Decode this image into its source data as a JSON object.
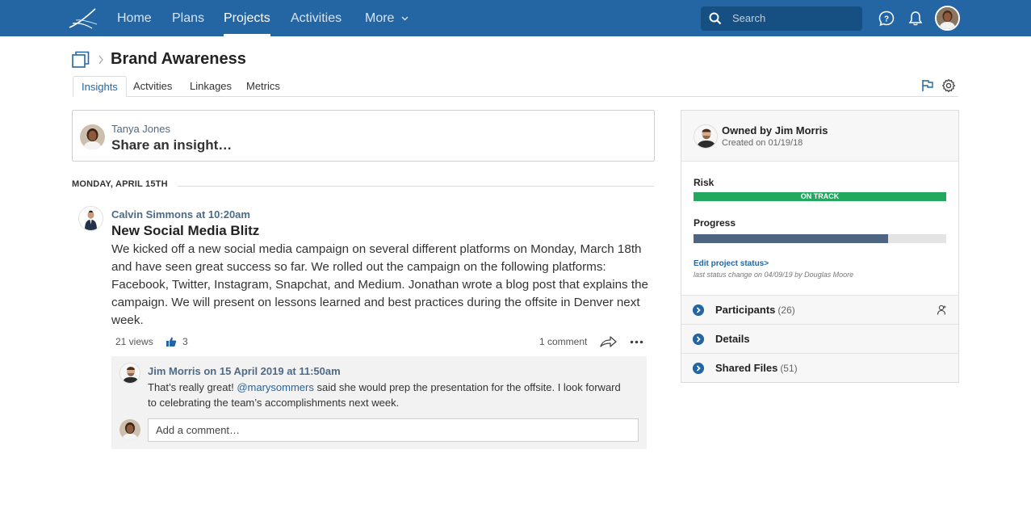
{
  "nav": {
    "items": [
      "Home",
      "Plans",
      "Projects",
      "Activities",
      "More"
    ],
    "active": "Projects",
    "search_placeholder": "Search",
    "brand_color": "#2366a3"
  },
  "page": {
    "title": "Brand Awareness",
    "tabs": [
      "Insights",
      "Actvities",
      "Linkages",
      "Metrics"
    ],
    "active_tab": "Insights"
  },
  "share": {
    "user": "Tanya Jones",
    "placeholder": "Share an insight…"
  },
  "day_header": "MONDAY, APRIL 15TH",
  "post": {
    "author_line": "Calvin Simmons at 10:20am",
    "title": "New Social Media Blitz",
    "body": "We kicked off a new social media campaign on several different platforms on Monday, March 18th and have seen great success so far. We rolled out the campaign on the following platforms: Facebook, Twitter, Instagram, Snapchat, and Medium. Jonathan wrote a blog post that explains the campaign. We will present on lessons learned and best practices during the offsite in Denver next week.",
    "views": "21 views",
    "likes": "3",
    "comments_count": "1 comment"
  },
  "comment": {
    "author_line": "Jim Morris on 15 April 2019 at 11:50am",
    "before_mention": "That’s really great! ",
    "mention": "@marysommers",
    "after_mention": " said she would prep the presentation for the offsite. I look forward to celebrating the team’s accomplishments next week.",
    "add_placeholder": "Add a comment…"
  },
  "panel": {
    "owner": "Owned by Jim Morris",
    "created": "Created on 01/19/18",
    "risk_label": "Risk",
    "risk_status": "ON TRACK",
    "risk_color": "#23a85f",
    "progress_label": "Progress",
    "progress_fraction": 0.77,
    "edit_link": "Edit project status>",
    "last_change": "last status change on 04/09/19 by Douglas Moore",
    "sections": [
      {
        "label": "Participants",
        "count": "(26)"
      },
      {
        "label": "Details",
        "count": ""
      },
      {
        "label": "Shared Files",
        "count": "(51)"
      }
    ]
  }
}
